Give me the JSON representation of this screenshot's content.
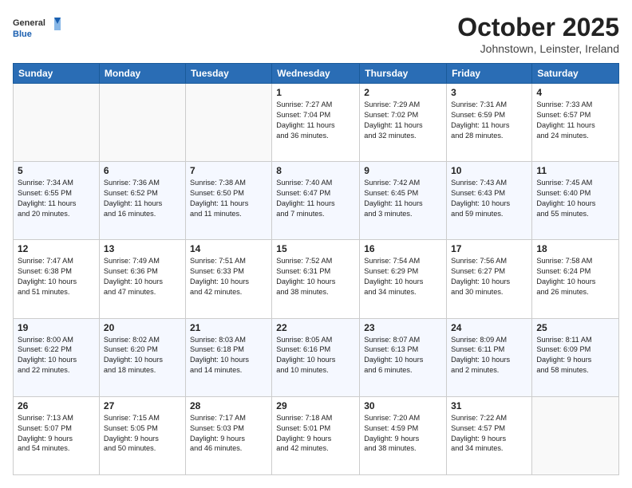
{
  "logo": {
    "general": "General",
    "blue": "Blue"
  },
  "header": {
    "month": "October 2025",
    "location": "Johnstown, Leinster, Ireland"
  },
  "weekdays": [
    "Sunday",
    "Monday",
    "Tuesday",
    "Wednesday",
    "Thursday",
    "Friday",
    "Saturday"
  ],
  "weeks": [
    [
      {
        "day": "",
        "info": ""
      },
      {
        "day": "",
        "info": ""
      },
      {
        "day": "",
        "info": ""
      },
      {
        "day": "1",
        "info": "Sunrise: 7:27 AM\nSunset: 7:04 PM\nDaylight: 11 hours\nand 36 minutes."
      },
      {
        "day": "2",
        "info": "Sunrise: 7:29 AM\nSunset: 7:02 PM\nDaylight: 11 hours\nand 32 minutes."
      },
      {
        "day": "3",
        "info": "Sunrise: 7:31 AM\nSunset: 6:59 PM\nDaylight: 11 hours\nand 28 minutes."
      },
      {
        "day": "4",
        "info": "Sunrise: 7:33 AM\nSunset: 6:57 PM\nDaylight: 11 hours\nand 24 minutes."
      }
    ],
    [
      {
        "day": "5",
        "info": "Sunrise: 7:34 AM\nSunset: 6:55 PM\nDaylight: 11 hours\nand 20 minutes."
      },
      {
        "day": "6",
        "info": "Sunrise: 7:36 AM\nSunset: 6:52 PM\nDaylight: 11 hours\nand 16 minutes."
      },
      {
        "day": "7",
        "info": "Sunrise: 7:38 AM\nSunset: 6:50 PM\nDaylight: 11 hours\nand 11 minutes."
      },
      {
        "day": "8",
        "info": "Sunrise: 7:40 AM\nSunset: 6:47 PM\nDaylight: 11 hours\nand 7 minutes."
      },
      {
        "day": "9",
        "info": "Sunrise: 7:42 AM\nSunset: 6:45 PM\nDaylight: 11 hours\nand 3 minutes."
      },
      {
        "day": "10",
        "info": "Sunrise: 7:43 AM\nSunset: 6:43 PM\nDaylight: 10 hours\nand 59 minutes."
      },
      {
        "day": "11",
        "info": "Sunrise: 7:45 AM\nSunset: 6:40 PM\nDaylight: 10 hours\nand 55 minutes."
      }
    ],
    [
      {
        "day": "12",
        "info": "Sunrise: 7:47 AM\nSunset: 6:38 PM\nDaylight: 10 hours\nand 51 minutes."
      },
      {
        "day": "13",
        "info": "Sunrise: 7:49 AM\nSunset: 6:36 PM\nDaylight: 10 hours\nand 47 minutes."
      },
      {
        "day": "14",
        "info": "Sunrise: 7:51 AM\nSunset: 6:33 PM\nDaylight: 10 hours\nand 42 minutes."
      },
      {
        "day": "15",
        "info": "Sunrise: 7:52 AM\nSunset: 6:31 PM\nDaylight: 10 hours\nand 38 minutes."
      },
      {
        "day": "16",
        "info": "Sunrise: 7:54 AM\nSunset: 6:29 PM\nDaylight: 10 hours\nand 34 minutes."
      },
      {
        "day": "17",
        "info": "Sunrise: 7:56 AM\nSunset: 6:27 PM\nDaylight: 10 hours\nand 30 minutes."
      },
      {
        "day": "18",
        "info": "Sunrise: 7:58 AM\nSunset: 6:24 PM\nDaylight: 10 hours\nand 26 minutes."
      }
    ],
    [
      {
        "day": "19",
        "info": "Sunrise: 8:00 AM\nSunset: 6:22 PM\nDaylight: 10 hours\nand 22 minutes."
      },
      {
        "day": "20",
        "info": "Sunrise: 8:02 AM\nSunset: 6:20 PM\nDaylight: 10 hours\nand 18 minutes."
      },
      {
        "day": "21",
        "info": "Sunrise: 8:03 AM\nSunset: 6:18 PM\nDaylight: 10 hours\nand 14 minutes."
      },
      {
        "day": "22",
        "info": "Sunrise: 8:05 AM\nSunset: 6:16 PM\nDaylight: 10 hours\nand 10 minutes."
      },
      {
        "day": "23",
        "info": "Sunrise: 8:07 AM\nSunset: 6:13 PM\nDaylight: 10 hours\nand 6 minutes."
      },
      {
        "day": "24",
        "info": "Sunrise: 8:09 AM\nSunset: 6:11 PM\nDaylight: 10 hours\nand 2 minutes."
      },
      {
        "day": "25",
        "info": "Sunrise: 8:11 AM\nSunset: 6:09 PM\nDaylight: 9 hours\nand 58 minutes."
      }
    ],
    [
      {
        "day": "26",
        "info": "Sunrise: 7:13 AM\nSunset: 5:07 PM\nDaylight: 9 hours\nand 54 minutes."
      },
      {
        "day": "27",
        "info": "Sunrise: 7:15 AM\nSunset: 5:05 PM\nDaylight: 9 hours\nand 50 minutes."
      },
      {
        "day": "28",
        "info": "Sunrise: 7:17 AM\nSunset: 5:03 PM\nDaylight: 9 hours\nand 46 minutes."
      },
      {
        "day": "29",
        "info": "Sunrise: 7:18 AM\nSunset: 5:01 PM\nDaylight: 9 hours\nand 42 minutes."
      },
      {
        "day": "30",
        "info": "Sunrise: 7:20 AM\nSunset: 4:59 PM\nDaylight: 9 hours\nand 38 minutes."
      },
      {
        "day": "31",
        "info": "Sunrise: 7:22 AM\nSunset: 4:57 PM\nDaylight: 9 hours\nand 34 minutes."
      },
      {
        "day": "",
        "info": ""
      }
    ]
  ]
}
